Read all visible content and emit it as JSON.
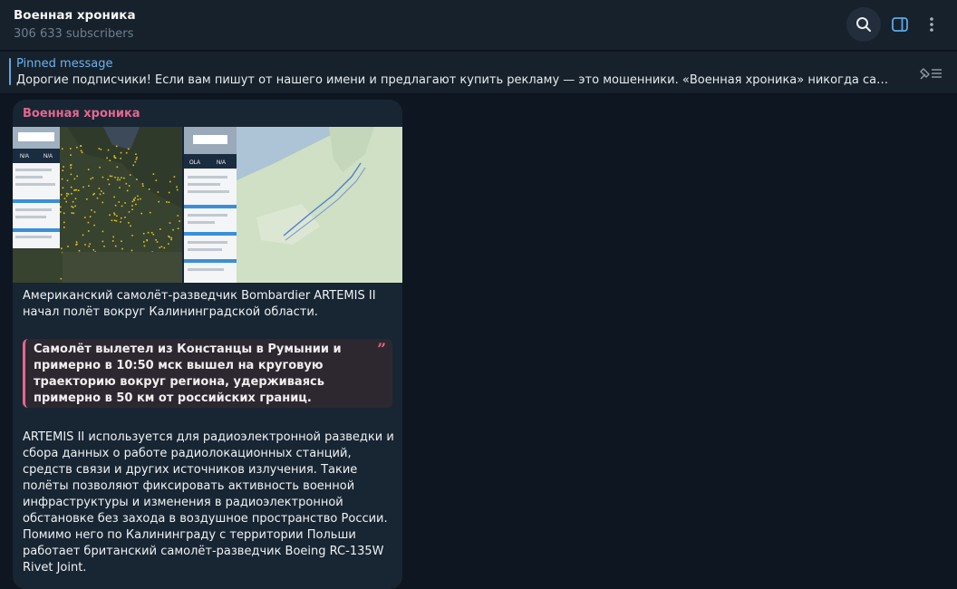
{
  "header": {
    "title": "Военная хроника",
    "subscribers": "306 633 subscribers",
    "icons": [
      "search-icon",
      "sidebar-toggle-icon",
      "more-vertical-icon"
    ]
  },
  "pinned": {
    "title": "Pinned message",
    "text": "Дорогие подписчики!   Если вам пишут от нашего имени и предлагают купить рекламу — это мошенники. «Военная хроника» никогда сама не предлагает",
    "icon": "unpin-icon"
  },
  "message": {
    "sender": "Военная хроника",
    "sender_color": "#e5668f",
    "photo1": {
      "left_code": "N/A",
      "right_code": "N/A"
    },
    "photo2": {
      "left_code": "OLA",
      "right_code": "N/A"
    },
    "paragraph1": "Американский самолёт-разведчик Bombardier ARTEMIS II начал полёт вокруг Калининградской области.",
    "quote": "Самолёт вылетел из Констанцы в Румынии и примерно в 10:50 мск вышел на круговую траекторию вокруг региона, удерживаясь примерно в 50 км от российских границ.",
    "quote_mark": "”",
    "paragraph2": "ARTEMIS II используется для радиоэлектронной разведки и сбора данных о работе радиолокационных станций, средств связи и других источников излучения. Такие полёты позволяют фиксировать активность военной инфраструктуры и изменения в радиоэлектронной обстановке без захода в воздушное пространство России. Помимо него по Калининграду с территории Польши работает британский самолёт-разведчик Boeing RC-135W Rivet Joint."
  },
  "colors": {
    "background": "#0e1621",
    "panel": "#17212b",
    "bubble": "#182533",
    "accent": "#6ab3f3"
  }
}
